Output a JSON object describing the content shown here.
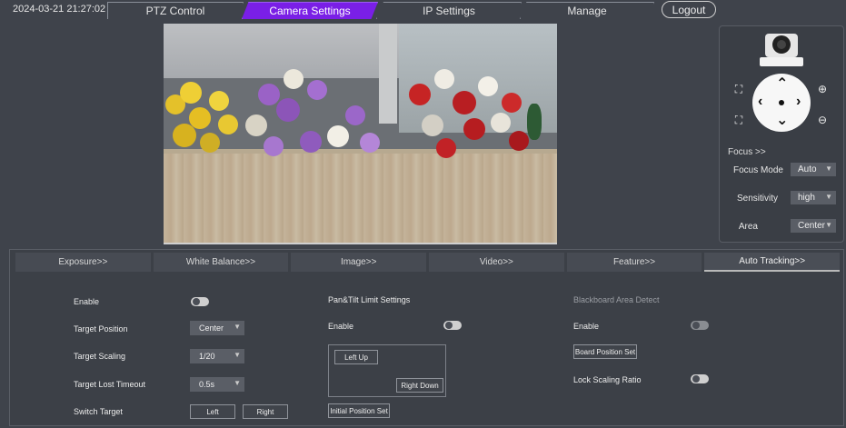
{
  "header": {
    "datetime": "2024-03-21 21:27:02",
    "tabs": [
      "PTZ Control",
      "Camera Settings",
      "IP Settings",
      "Manage"
    ],
    "active_tab": "Camera Settings",
    "logout_label": "Logout"
  },
  "ptz": {
    "focus_title": "Focus >>",
    "focus_mode_label": "Focus Mode",
    "focus_mode_value": "Auto",
    "sensitivity_label": "Sensitivity",
    "sensitivity_value": "high",
    "area_label": "Area",
    "area_value": "Center",
    "icons": [
      "camera-icon",
      "arrow-up-icon",
      "arrow-down-icon",
      "arrow-left-icon",
      "arrow-right-icon",
      "zoom-in-icon",
      "zoom-out-icon",
      "focus-near-icon",
      "focus-far-icon"
    ]
  },
  "subtabs": [
    "Exposure>>",
    "White Balance>>",
    "Image>>",
    "Video>>",
    "Feature>>",
    "Auto Tracking>>"
  ],
  "active_subtab": "Auto Tracking>>",
  "tracking": {
    "enable_label": "Enable",
    "target_position_label": "Target Position",
    "target_position_value": "Center",
    "target_scaling_label": "Target Scaling",
    "target_scaling_value": "1/20",
    "target_lost_label": "Target Lost Timeout",
    "target_lost_value": "0.5s",
    "switch_target_label": "Switch Target",
    "left_btn": "Left",
    "right_btn": "Right"
  },
  "pantilt": {
    "title": "Pan&Tilt Limit Settings",
    "enable_label": "Enable",
    "left_up_btn": "Left Up",
    "right_down_btn": "Right Down",
    "initial_btn": "Initial Position Set"
  },
  "blackboard": {
    "title": "Blackboard Area Detect",
    "enable_label": "Enable",
    "board_btn": "Board Position Set",
    "lock_label": "Lock Scaling Ratio"
  },
  "colors": {
    "accent": "#7a1fe6",
    "background": "#3f434b"
  }
}
